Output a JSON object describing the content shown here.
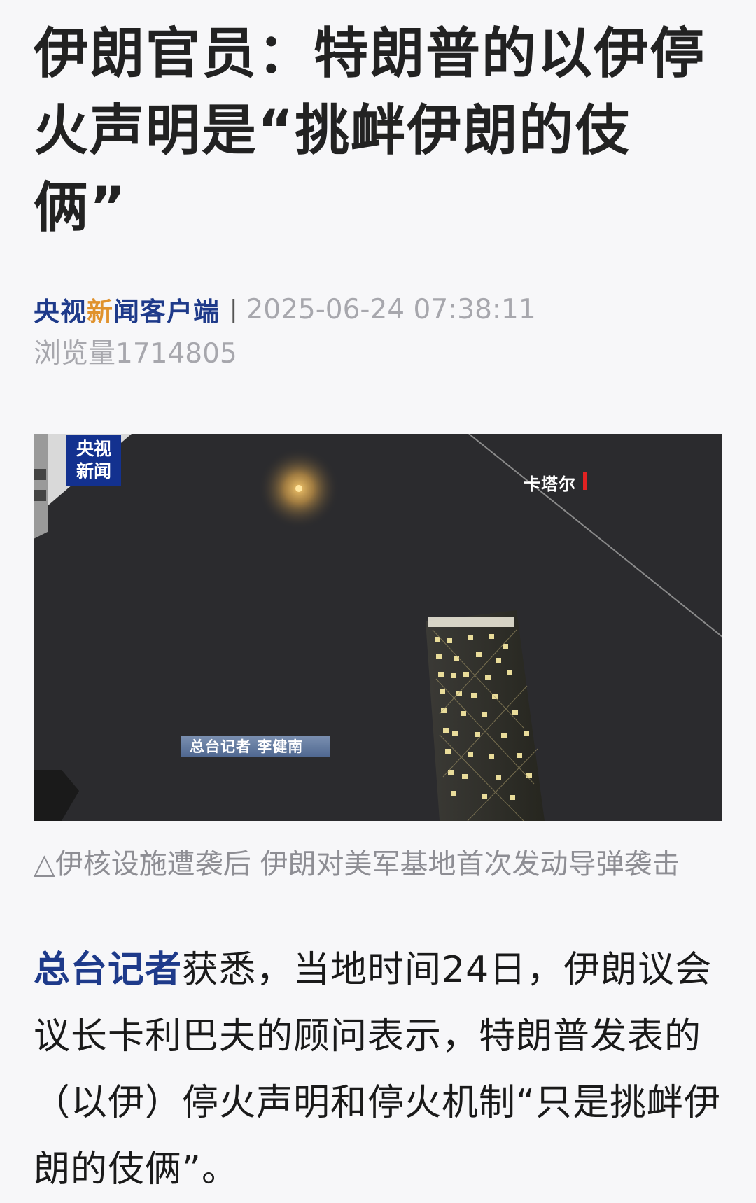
{
  "article": {
    "headline_line1": "伊朗官员：特朗普的以伊停",
    "headline_line2": "火声明是“挑衅伊朗的伎俩”",
    "source_part1": "央视",
    "source_accent": "新",
    "source_part2": "闻客户端",
    "divider": "|",
    "date": "2025-06-24 07:38:11",
    "views": "浏览量1714805"
  },
  "photo": {
    "logo_line1": "央视",
    "logo_line2": "新闻",
    "location": "卡塔尔",
    "reporter": "总台记者 李健南",
    "caption": "△伊核设施遭袭后 伊朗对美军基地首次发动导弹袭击"
  },
  "body": {
    "lead": "总台记者",
    "text": "获悉，当地时间24日，伊朗议会议长卡利巴夫的顾问表示，特朗普发表的（以伊）停火声明和停火机制“只是挑衅伊朗的伎俩”。"
  },
  "colors": {
    "source_blue": "#1e3a8a",
    "source_accent_orange": "#e0922d",
    "location_red": "#e22222",
    "logo_blue": "#13318f"
  }
}
